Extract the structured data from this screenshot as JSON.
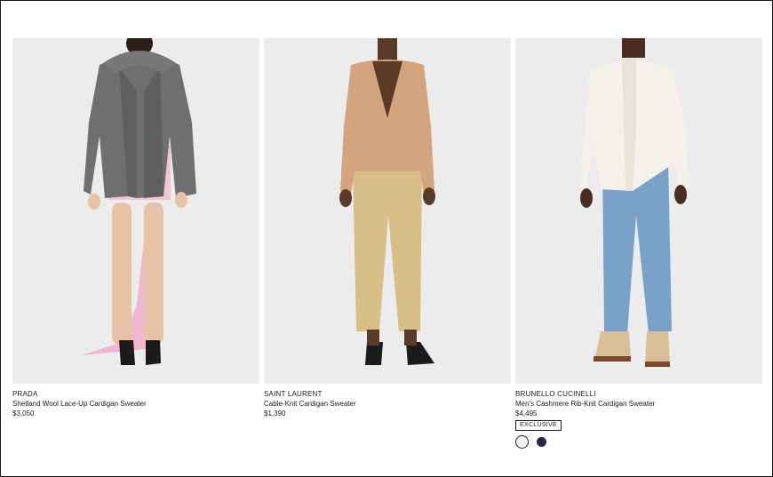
{
  "products": [
    {
      "brand": "PRADA",
      "name": "Shetland Wool Lace-Up Cardigan Sweater",
      "price": "$3,050"
    },
    {
      "brand": "SAINT LAURENT",
      "name": "Cable-Knit Cardigan Sweater",
      "price": "$1,390"
    },
    {
      "brand": "BRUNELLO CUCINELLI",
      "name": "Men's Cashmere Rib-Knit Cardigan Sweater",
      "price": "$4,495",
      "badge": "EXCLUSIVE",
      "swatches": [
        {
          "color": "#f4f1e8",
          "selected": true
        },
        {
          "color": "#1f2a4d",
          "selected": false
        }
      ]
    }
  ]
}
